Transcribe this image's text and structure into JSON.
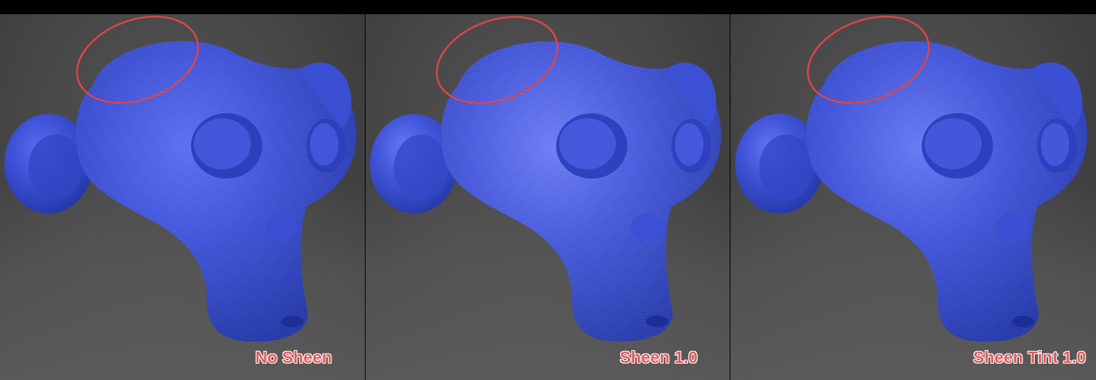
{
  "panels": [
    {
      "caption": "No Sheen"
    },
    {
      "caption": "Sheen 1.0"
    },
    {
      "caption": "Sheen Tint 1.0"
    }
  ],
  "colors": {
    "background_top": "#000000",
    "panel_background": "#4a4a4a",
    "mesh_blue": "#3a4fd0",
    "highlight_ring": "#e04545",
    "caption_fill": "#e25a5a",
    "caption_outline": "#ffffff"
  }
}
